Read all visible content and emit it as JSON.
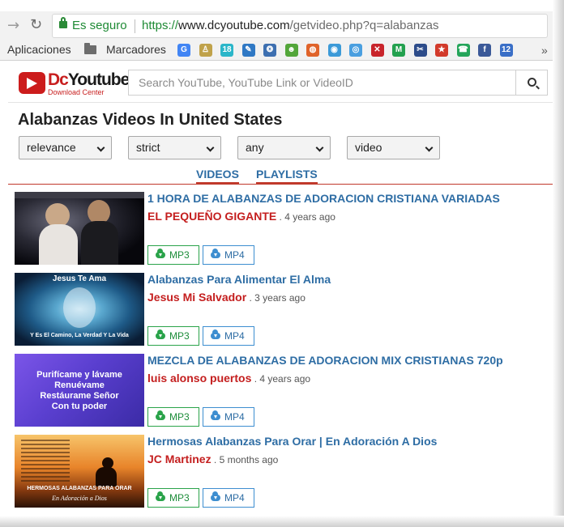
{
  "browser": {
    "secure_label": "Es seguro",
    "url_protocol": "https://",
    "url_host": "www.dcyoutube.com",
    "url_path": "/getvideo.php?q=alabanzas",
    "bookmarks": {
      "apps_label": "Aplicaciones",
      "folder_label": "Marcadores",
      "favicons": [
        {
          "name": "google-icon",
          "glyph": "G",
          "color": "#4285f4"
        },
        {
          "name": "bookmark-figure-icon",
          "glyph": "♙",
          "color": "#c0a24a"
        },
        {
          "name": "bookmark-teal-icon",
          "glyph": "18",
          "color": "#2bb6c9"
        },
        {
          "name": "bookmark-blue-pen-icon",
          "glyph": "✎",
          "color": "#2f78c4"
        },
        {
          "name": "bookmark-spiral-icon",
          "glyph": "❂",
          "color": "#3d6fb0"
        },
        {
          "name": "bookmark-green-icon",
          "glyph": "☻",
          "color": "#53a63a"
        },
        {
          "name": "bookmark-orange-icon",
          "glyph": "◍",
          "color": "#e0632a"
        },
        {
          "name": "bookmark-disc-icon",
          "glyph": "◉",
          "color": "#3c9ad8"
        },
        {
          "name": "bookmark-swirl-icon",
          "glyph": "◎",
          "color": "#4a9fe0"
        },
        {
          "name": "bookmark-red-icon",
          "glyph": "✕",
          "color": "#c8242b"
        },
        {
          "name": "bookmark-m-icon",
          "glyph": "M",
          "color": "#23a14f"
        },
        {
          "name": "scissors-icon",
          "glyph": "✂",
          "color": "#2d4c8a"
        },
        {
          "name": "bookmark-star-icon",
          "glyph": "★",
          "color": "#d23a2a"
        },
        {
          "name": "whatsapp-icon",
          "glyph": "☎",
          "color": "#25a55a"
        },
        {
          "name": "facebook-icon",
          "glyph": "f",
          "color": "#3b5998"
        },
        {
          "name": "calendar-icon",
          "glyph": "12",
          "color": "#3a6fc7"
        }
      ],
      "more_glyph": "»"
    }
  },
  "site": {
    "logo_dc": "Dc",
    "logo_yt": "Youtube",
    "logo_sub": "Download Center",
    "search_placeholder": "Search YouTube, YouTube Link or VideoID"
  },
  "page": {
    "title": "Alabanzas Videos In United States",
    "filters": [
      {
        "name": "sort-select",
        "value": "relevance"
      },
      {
        "name": "safesearch-select",
        "value": "strict"
      },
      {
        "name": "duration-select",
        "value": "any"
      },
      {
        "name": "type-select",
        "value": "video"
      }
    ],
    "tabs": [
      {
        "name": "tab-videos",
        "label": "VIDEOS"
      },
      {
        "name": "tab-playlists",
        "label": "PLAYLISTS"
      }
    ]
  },
  "results": [
    {
      "title": "1 HORA DE ALABANZAS DE ADORACION CRISTIANA VARIADAS",
      "channel": "EL PEQUEÑO GIGANTE",
      "age": " . 4 years ago",
      "mp3": "MP3",
      "mp4": "MP4",
      "thumb_lines": []
    },
    {
      "title": "Alabanzas Para Alimentar El Alma",
      "channel": "Jesus Mi Salvador",
      "age": " . 3 years ago",
      "mp3": "MP3",
      "mp4": "MP4",
      "thumb_lines": [
        "Jesus Te Ama",
        "Y Es El Camino, La Verdad Y La Vida"
      ]
    },
    {
      "title": "MEZCLA DE ALABANZAS DE ADORACION MIX CRISTIANAS 720p",
      "channel": "luis alonso puertos",
      "age": " . 4 years ago",
      "mp3": "MP3",
      "mp4": "MP4",
      "thumb_lines": [
        "Purifícame y lávame",
        "Renuévame",
        "Restáurame Señor",
        "Con tu poder"
      ]
    },
    {
      "title": "Hermosas Alabanzas Para Orar | En Adoración A Dios",
      "channel": "JC Martinez",
      "age": " . 5 months ago",
      "mp3": "MP3",
      "mp4": "MP4",
      "thumb_lines": [
        "HERMOSAS ALABANZAS PARA ORAR",
        "En Adoración a Dios"
      ]
    }
  ]
}
